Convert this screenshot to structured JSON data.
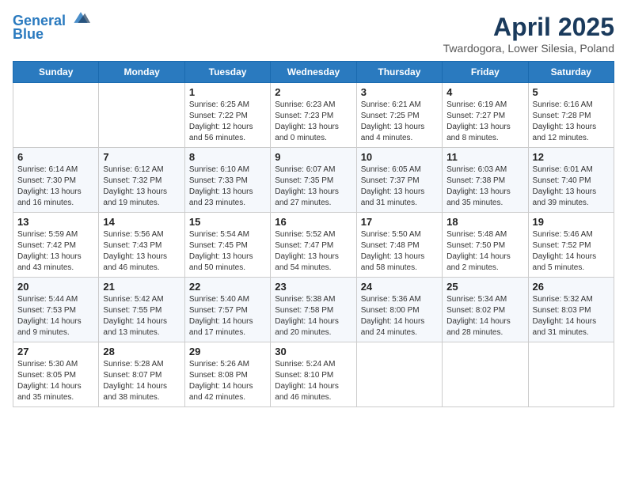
{
  "logo": {
    "line1": "General",
    "line2": "Blue"
  },
  "title": "April 2025",
  "location": "Twardogora, Lower Silesia, Poland",
  "headers": [
    "Sunday",
    "Monday",
    "Tuesday",
    "Wednesday",
    "Thursday",
    "Friday",
    "Saturday"
  ],
  "weeks": [
    [
      {
        "day": "",
        "info": ""
      },
      {
        "day": "",
        "info": ""
      },
      {
        "day": "1",
        "info": "Sunrise: 6:25 AM\nSunset: 7:22 PM\nDaylight: 12 hours\nand 56 minutes."
      },
      {
        "day": "2",
        "info": "Sunrise: 6:23 AM\nSunset: 7:23 PM\nDaylight: 13 hours\nand 0 minutes."
      },
      {
        "day": "3",
        "info": "Sunrise: 6:21 AM\nSunset: 7:25 PM\nDaylight: 13 hours\nand 4 minutes."
      },
      {
        "day": "4",
        "info": "Sunrise: 6:19 AM\nSunset: 7:27 PM\nDaylight: 13 hours\nand 8 minutes."
      },
      {
        "day": "5",
        "info": "Sunrise: 6:16 AM\nSunset: 7:28 PM\nDaylight: 13 hours\nand 12 minutes."
      }
    ],
    [
      {
        "day": "6",
        "info": "Sunrise: 6:14 AM\nSunset: 7:30 PM\nDaylight: 13 hours\nand 16 minutes."
      },
      {
        "day": "7",
        "info": "Sunrise: 6:12 AM\nSunset: 7:32 PM\nDaylight: 13 hours\nand 19 minutes."
      },
      {
        "day": "8",
        "info": "Sunrise: 6:10 AM\nSunset: 7:33 PM\nDaylight: 13 hours\nand 23 minutes."
      },
      {
        "day": "9",
        "info": "Sunrise: 6:07 AM\nSunset: 7:35 PM\nDaylight: 13 hours\nand 27 minutes."
      },
      {
        "day": "10",
        "info": "Sunrise: 6:05 AM\nSunset: 7:37 PM\nDaylight: 13 hours\nand 31 minutes."
      },
      {
        "day": "11",
        "info": "Sunrise: 6:03 AM\nSunset: 7:38 PM\nDaylight: 13 hours\nand 35 minutes."
      },
      {
        "day": "12",
        "info": "Sunrise: 6:01 AM\nSunset: 7:40 PM\nDaylight: 13 hours\nand 39 minutes."
      }
    ],
    [
      {
        "day": "13",
        "info": "Sunrise: 5:59 AM\nSunset: 7:42 PM\nDaylight: 13 hours\nand 43 minutes."
      },
      {
        "day": "14",
        "info": "Sunrise: 5:56 AM\nSunset: 7:43 PM\nDaylight: 13 hours\nand 46 minutes."
      },
      {
        "day": "15",
        "info": "Sunrise: 5:54 AM\nSunset: 7:45 PM\nDaylight: 13 hours\nand 50 minutes."
      },
      {
        "day": "16",
        "info": "Sunrise: 5:52 AM\nSunset: 7:47 PM\nDaylight: 13 hours\nand 54 minutes."
      },
      {
        "day": "17",
        "info": "Sunrise: 5:50 AM\nSunset: 7:48 PM\nDaylight: 13 hours\nand 58 minutes."
      },
      {
        "day": "18",
        "info": "Sunrise: 5:48 AM\nSunset: 7:50 PM\nDaylight: 14 hours\nand 2 minutes."
      },
      {
        "day": "19",
        "info": "Sunrise: 5:46 AM\nSunset: 7:52 PM\nDaylight: 14 hours\nand 5 minutes."
      }
    ],
    [
      {
        "day": "20",
        "info": "Sunrise: 5:44 AM\nSunset: 7:53 PM\nDaylight: 14 hours\nand 9 minutes."
      },
      {
        "day": "21",
        "info": "Sunrise: 5:42 AM\nSunset: 7:55 PM\nDaylight: 14 hours\nand 13 minutes."
      },
      {
        "day": "22",
        "info": "Sunrise: 5:40 AM\nSunset: 7:57 PM\nDaylight: 14 hours\nand 17 minutes."
      },
      {
        "day": "23",
        "info": "Sunrise: 5:38 AM\nSunset: 7:58 PM\nDaylight: 14 hours\nand 20 minutes."
      },
      {
        "day": "24",
        "info": "Sunrise: 5:36 AM\nSunset: 8:00 PM\nDaylight: 14 hours\nand 24 minutes."
      },
      {
        "day": "25",
        "info": "Sunrise: 5:34 AM\nSunset: 8:02 PM\nDaylight: 14 hours\nand 28 minutes."
      },
      {
        "day": "26",
        "info": "Sunrise: 5:32 AM\nSunset: 8:03 PM\nDaylight: 14 hours\nand 31 minutes."
      }
    ],
    [
      {
        "day": "27",
        "info": "Sunrise: 5:30 AM\nSunset: 8:05 PM\nDaylight: 14 hours\nand 35 minutes."
      },
      {
        "day": "28",
        "info": "Sunrise: 5:28 AM\nSunset: 8:07 PM\nDaylight: 14 hours\nand 38 minutes."
      },
      {
        "day": "29",
        "info": "Sunrise: 5:26 AM\nSunset: 8:08 PM\nDaylight: 14 hours\nand 42 minutes."
      },
      {
        "day": "30",
        "info": "Sunrise: 5:24 AM\nSunset: 8:10 PM\nDaylight: 14 hours\nand 46 minutes."
      },
      {
        "day": "",
        "info": ""
      },
      {
        "day": "",
        "info": ""
      },
      {
        "day": "",
        "info": ""
      }
    ]
  ]
}
